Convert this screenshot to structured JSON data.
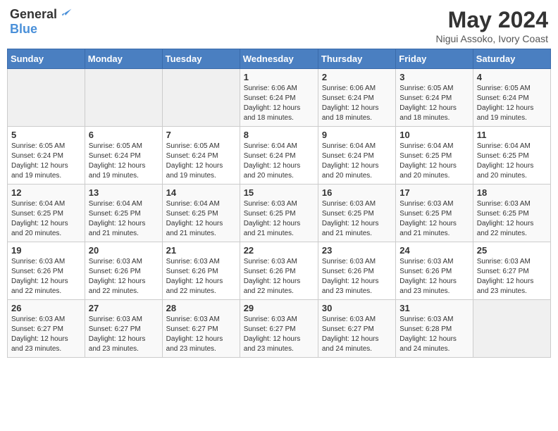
{
  "logo": {
    "general": "General",
    "blue": "Blue"
  },
  "header": {
    "month_year": "May 2024",
    "location": "Nigui Assoko, Ivory Coast"
  },
  "weekdays": [
    "Sunday",
    "Monday",
    "Tuesday",
    "Wednesday",
    "Thursday",
    "Friday",
    "Saturday"
  ],
  "weeks": [
    [
      {
        "day": "",
        "info": ""
      },
      {
        "day": "",
        "info": ""
      },
      {
        "day": "",
        "info": ""
      },
      {
        "day": "1",
        "info": "Sunrise: 6:06 AM\nSunset: 6:24 PM\nDaylight: 12 hours\nand 18 minutes."
      },
      {
        "day": "2",
        "info": "Sunrise: 6:06 AM\nSunset: 6:24 PM\nDaylight: 12 hours\nand 18 minutes."
      },
      {
        "day": "3",
        "info": "Sunrise: 6:05 AM\nSunset: 6:24 PM\nDaylight: 12 hours\nand 18 minutes."
      },
      {
        "day": "4",
        "info": "Sunrise: 6:05 AM\nSunset: 6:24 PM\nDaylight: 12 hours\nand 19 minutes."
      }
    ],
    [
      {
        "day": "5",
        "info": "Sunrise: 6:05 AM\nSunset: 6:24 PM\nDaylight: 12 hours\nand 19 minutes."
      },
      {
        "day": "6",
        "info": "Sunrise: 6:05 AM\nSunset: 6:24 PM\nDaylight: 12 hours\nand 19 minutes."
      },
      {
        "day": "7",
        "info": "Sunrise: 6:05 AM\nSunset: 6:24 PM\nDaylight: 12 hours\nand 19 minutes."
      },
      {
        "day": "8",
        "info": "Sunrise: 6:04 AM\nSunset: 6:24 PM\nDaylight: 12 hours\nand 20 minutes."
      },
      {
        "day": "9",
        "info": "Sunrise: 6:04 AM\nSunset: 6:24 PM\nDaylight: 12 hours\nand 20 minutes."
      },
      {
        "day": "10",
        "info": "Sunrise: 6:04 AM\nSunset: 6:25 PM\nDaylight: 12 hours\nand 20 minutes."
      },
      {
        "day": "11",
        "info": "Sunrise: 6:04 AM\nSunset: 6:25 PM\nDaylight: 12 hours\nand 20 minutes."
      }
    ],
    [
      {
        "day": "12",
        "info": "Sunrise: 6:04 AM\nSunset: 6:25 PM\nDaylight: 12 hours\nand 20 minutes."
      },
      {
        "day": "13",
        "info": "Sunrise: 6:04 AM\nSunset: 6:25 PM\nDaylight: 12 hours\nand 21 minutes."
      },
      {
        "day": "14",
        "info": "Sunrise: 6:04 AM\nSunset: 6:25 PM\nDaylight: 12 hours\nand 21 minutes."
      },
      {
        "day": "15",
        "info": "Sunrise: 6:03 AM\nSunset: 6:25 PM\nDaylight: 12 hours\nand 21 minutes."
      },
      {
        "day": "16",
        "info": "Sunrise: 6:03 AM\nSunset: 6:25 PM\nDaylight: 12 hours\nand 21 minutes."
      },
      {
        "day": "17",
        "info": "Sunrise: 6:03 AM\nSunset: 6:25 PM\nDaylight: 12 hours\nand 21 minutes."
      },
      {
        "day": "18",
        "info": "Sunrise: 6:03 AM\nSunset: 6:25 PM\nDaylight: 12 hours\nand 22 minutes."
      }
    ],
    [
      {
        "day": "19",
        "info": "Sunrise: 6:03 AM\nSunset: 6:26 PM\nDaylight: 12 hours\nand 22 minutes."
      },
      {
        "day": "20",
        "info": "Sunrise: 6:03 AM\nSunset: 6:26 PM\nDaylight: 12 hours\nand 22 minutes."
      },
      {
        "day": "21",
        "info": "Sunrise: 6:03 AM\nSunset: 6:26 PM\nDaylight: 12 hours\nand 22 minutes."
      },
      {
        "day": "22",
        "info": "Sunrise: 6:03 AM\nSunset: 6:26 PM\nDaylight: 12 hours\nand 22 minutes."
      },
      {
        "day": "23",
        "info": "Sunrise: 6:03 AM\nSunset: 6:26 PM\nDaylight: 12 hours\nand 23 minutes."
      },
      {
        "day": "24",
        "info": "Sunrise: 6:03 AM\nSunset: 6:26 PM\nDaylight: 12 hours\nand 23 minutes."
      },
      {
        "day": "25",
        "info": "Sunrise: 6:03 AM\nSunset: 6:27 PM\nDaylight: 12 hours\nand 23 minutes."
      }
    ],
    [
      {
        "day": "26",
        "info": "Sunrise: 6:03 AM\nSunset: 6:27 PM\nDaylight: 12 hours\nand 23 minutes."
      },
      {
        "day": "27",
        "info": "Sunrise: 6:03 AM\nSunset: 6:27 PM\nDaylight: 12 hours\nand 23 minutes."
      },
      {
        "day": "28",
        "info": "Sunrise: 6:03 AM\nSunset: 6:27 PM\nDaylight: 12 hours\nand 23 minutes."
      },
      {
        "day": "29",
        "info": "Sunrise: 6:03 AM\nSunset: 6:27 PM\nDaylight: 12 hours\nand 23 minutes."
      },
      {
        "day": "30",
        "info": "Sunrise: 6:03 AM\nSunset: 6:27 PM\nDaylight: 12 hours\nand 24 minutes."
      },
      {
        "day": "31",
        "info": "Sunrise: 6:03 AM\nSunset: 6:28 PM\nDaylight: 12 hours\nand 24 minutes."
      },
      {
        "day": "",
        "info": ""
      }
    ]
  ]
}
